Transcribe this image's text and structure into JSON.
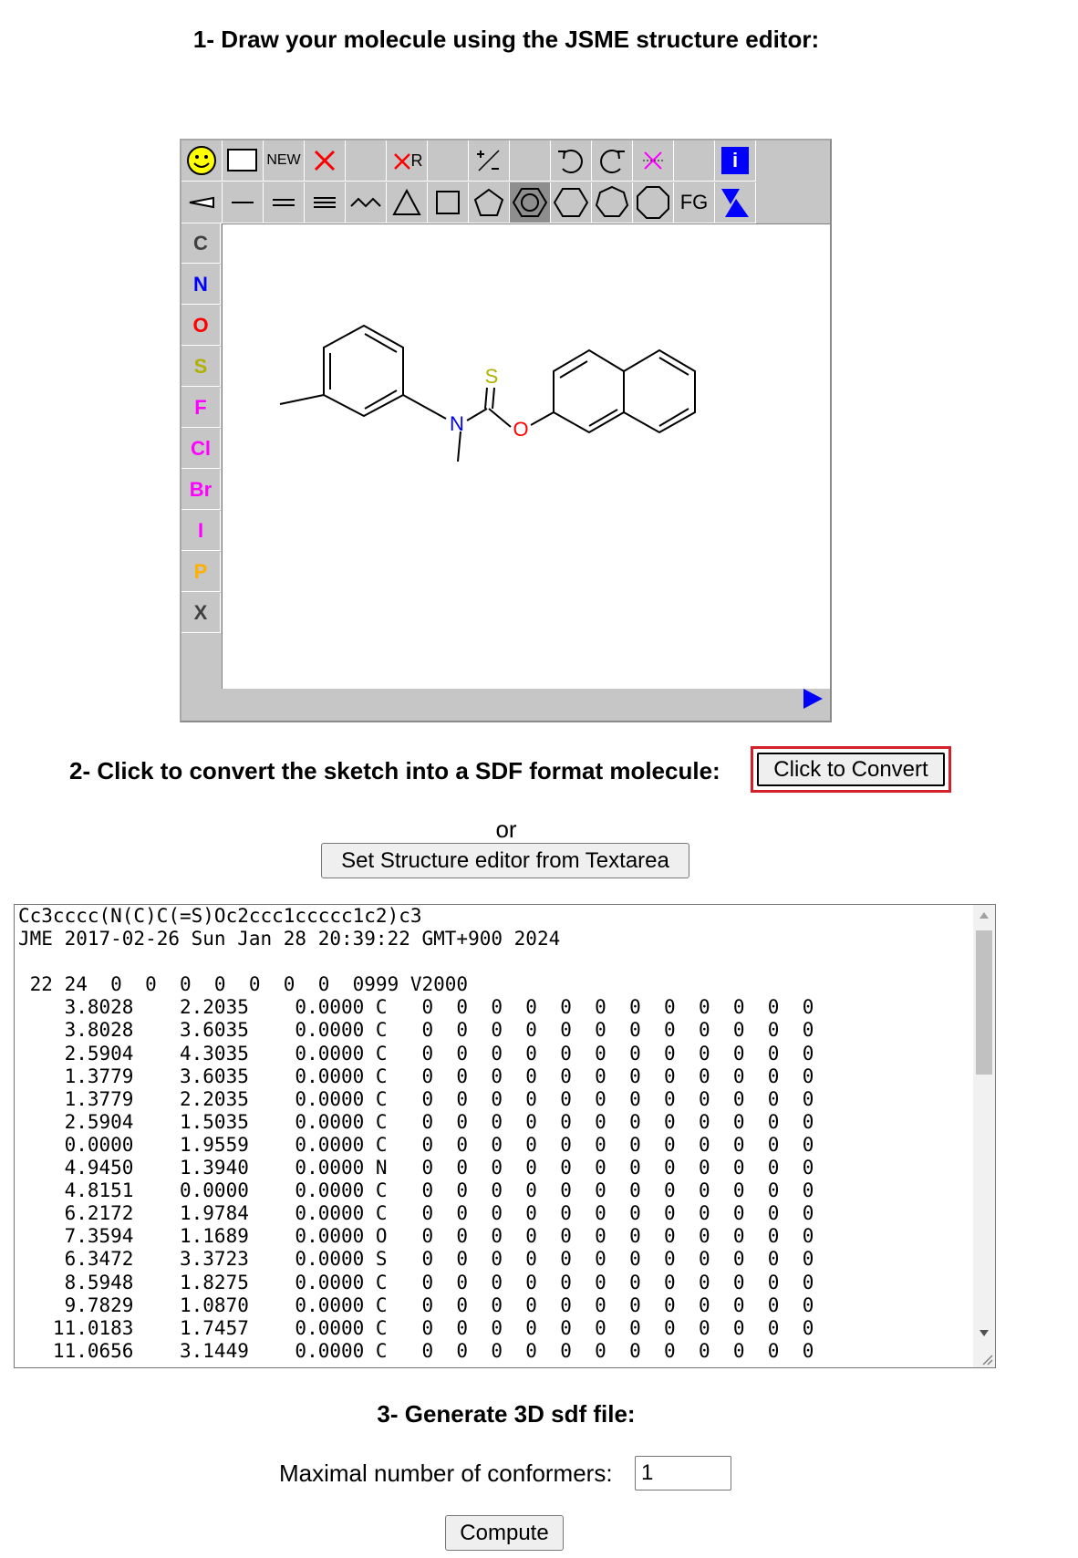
{
  "step1": {
    "title": "1- Draw your molecule using the JSME structure editor:"
  },
  "editor": {
    "top_toolbar": [
      "smiley-icon",
      "rectangle-icon",
      "NEW",
      "delete-icon",
      "",
      "R",
      "",
      "charge-icon",
      "",
      "undo-icon",
      "redo-icon",
      "clear-cross-icon",
      "",
      "i"
    ],
    "bond_toolbar": [
      "wedge-bond-icon",
      "single-bond-icon",
      "double-bond-icon",
      "triple-bond-icon",
      "chain-icon",
      "triangle-ring-icon",
      "square-ring-icon",
      "pentagon-ring-icon",
      "benzene-ring-icon",
      "hexagon-ring-icon",
      "heptagon-ring-icon",
      "octagon-ring-icon",
      "FG",
      "triangles-icon"
    ],
    "new_label": "NEW",
    "r_label": "R",
    "fg_label": "FG",
    "info_label": "i",
    "atoms": [
      {
        "symbol": "C",
        "color": "#404040"
      },
      {
        "symbol": "N",
        "color": "#0000ff"
      },
      {
        "symbol": "O",
        "color": "#ff0000"
      },
      {
        "symbol": "S",
        "color": "#b0b000"
      },
      {
        "symbol": "F",
        "color": "#ff00ff"
      },
      {
        "symbol": "Cl",
        "color": "#ff00ff"
      },
      {
        "symbol": "Br",
        "color": "#ff00ff"
      },
      {
        "symbol": "I",
        "color": "#ff00ff"
      },
      {
        "symbol": "P",
        "color": "#ffb000"
      },
      {
        "symbol": "X",
        "color": "#404040"
      }
    ],
    "molecule_labels": {
      "nitrogen": "N",
      "oxygen": "O",
      "sulfur": "S"
    }
  },
  "step2": {
    "title": "2- Click to convert the sketch into a SDF format molecule:",
    "convert_label": "Click to Convert",
    "or_text": "or",
    "set_structure_label": "Set Structure editor from Textarea"
  },
  "sdf": {
    "text": "Cc3cccc(N(C)C(=S)Oc2ccc1ccccc1c2)c3\nJME 2017-02-26 Sun Jan 28 20:39:22 GMT+900 2024\n\n 22 24  0  0  0  0  0  0  0  0999 V2000\n    3.8028    2.2035    0.0000 C   0  0  0  0  0  0  0  0  0  0  0  0\n    3.8028    3.6035    0.0000 C   0  0  0  0  0  0  0  0  0  0  0  0\n    2.5904    4.3035    0.0000 C   0  0  0  0  0  0  0  0  0  0  0  0\n    1.3779    3.6035    0.0000 C   0  0  0  0  0  0  0  0  0  0  0  0\n    1.3779    2.2035    0.0000 C   0  0  0  0  0  0  0  0  0  0  0  0\n    2.5904    1.5035    0.0000 C   0  0  0  0  0  0  0  0  0  0  0  0\n    0.0000    1.9559    0.0000 C   0  0  0  0  0  0  0  0  0  0  0  0\n    4.9450    1.3940    0.0000 N   0  0  0  0  0  0  0  0  0  0  0  0\n    4.8151    0.0000    0.0000 C   0  0  0  0  0  0  0  0  0  0  0  0\n    6.2172    1.9784    0.0000 C   0  0  0  0  0  0  0  0  0  0  0  0\n    7.3594    1.1689    0.0000 O   0  0  0  0  0  0  0  0  0  0  0  0\n    6.3472    3.3723    0.0000 S   0  0  0  0  0  0  0  0  0  0  0  0\n    8.5948    1.8275    0.0000 C   0  0  0  0  0  0  0  0  0  0  0  0\n    9.7829    1.0870    0.0000 C   0  0  0  0  0  0  0  0  0  0  0  0\n   11.0183    1.7457    0.0000 C   0  0  0  0  0  0  0  0  0  0  0  0\n   11.0656    3.1449    0.0000 C   0  0  0  0  0  0  0  0  0  0  0  0"
  },
  "step3": {
    "title": "3- Generate 3D sdf file:",
    "conformers_label": "Maximal number of conformers:",
    "conformers_value": "1",
    "compute_label": "Compute"
  }
}
